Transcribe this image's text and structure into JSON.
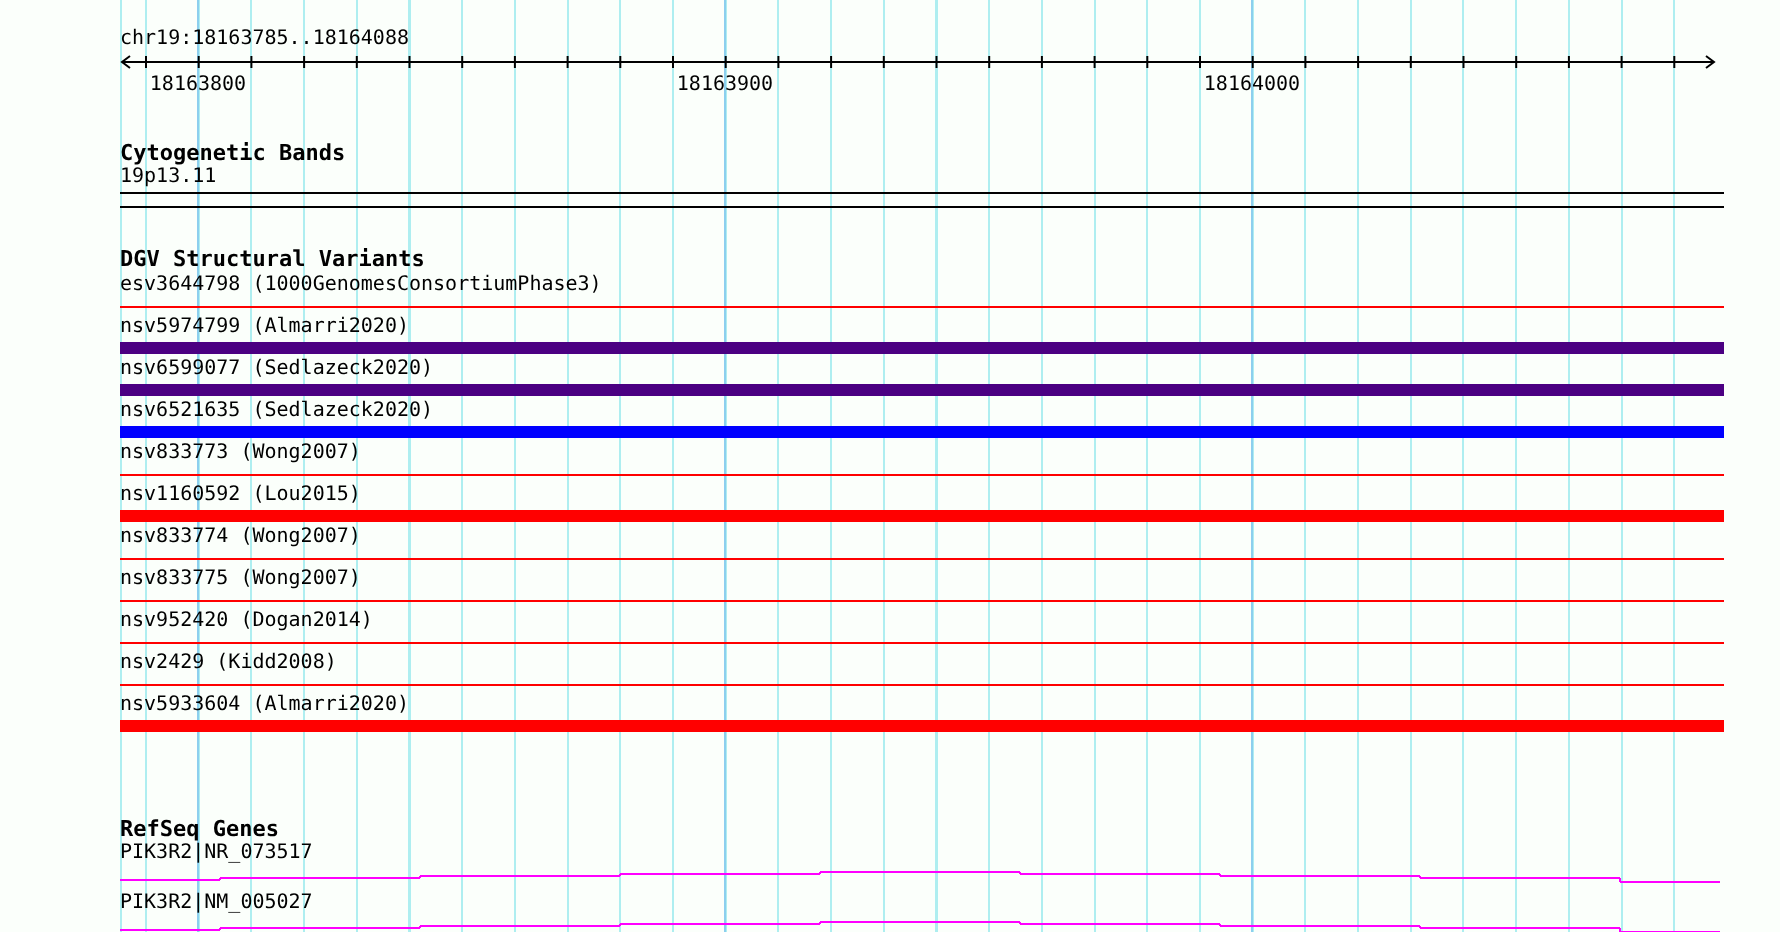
{
  "location": "chr19:18163785..18164088",
  "ruler": {
    "labels": [
      "18163800",
      "18163900",
      "18164000"
    ]
  },
  "tracks": [
    {
      "kind": "cytoband",
      "title": "Cytogenetic Bands",
      "features": [
        {
          "label": "19p13.11"
        }
      ]
    },
    {
      "kind": "variants",
      "title": "DGV Structural Variants",
      "features": [
        {
          "label": "esv3644798 (1000GenomesConsortiumPhase3)",
          "kind": "thin",
          "color": "#ff0000"
        },
        {
          "label": "nsv5974799 (Almarri2020)",
          "kind": "thick",
          "color": "#4b0082"
        },
        {
          "label": "nsv6599077 (Sedlazeck2020)",
          "kind": "thick",
          "color": "#4b0082"
        },
        {
          "label": "nsv6521635 (Sedlazeck2020)",
          "kind": "thick",
          "color": "#0000ff"
        },
        {
          "label": "nsv833773 (Wong2007)",
          "kind": "thin",
          "color": "#ff0000"
        },
        {
          "label": "nsv1160592 (Lou2015)",
          "kind": "thick",
          "color": "#ff0000"
        },
        {
          "label": "nsv833774 (Wong2007)",
          "kind": "thin",
          "color": "#ff0000"
        },
        {
          "label": "nsv833775 (Wong2007)",
          "kind": "thin",
          "color": "#ff0000"
        },
        {
          "label": "nsv952420 (Dogan2014)",
          "kind": "thin",
          "color": "#ff0000"
        },
        {
          "label": "nsv2429 (Kidd2008)",
          "kind": "thin",
          "color": "#ff0000"
        },
        {
          "label": "nsv5933604 (Almarri2020)",
          "kind": "thick",
          "color": "#ff0000"
        }
      ]
    },
    {
      "kind": "genes",
      "title": "RefSeq Genes",
      "features": [
        {
          "label": "PIK3R2|NR_073517"
        },
        {
          "label": "PIK3R2|NM_005027"
        }
      ]
    }
  ]
}
